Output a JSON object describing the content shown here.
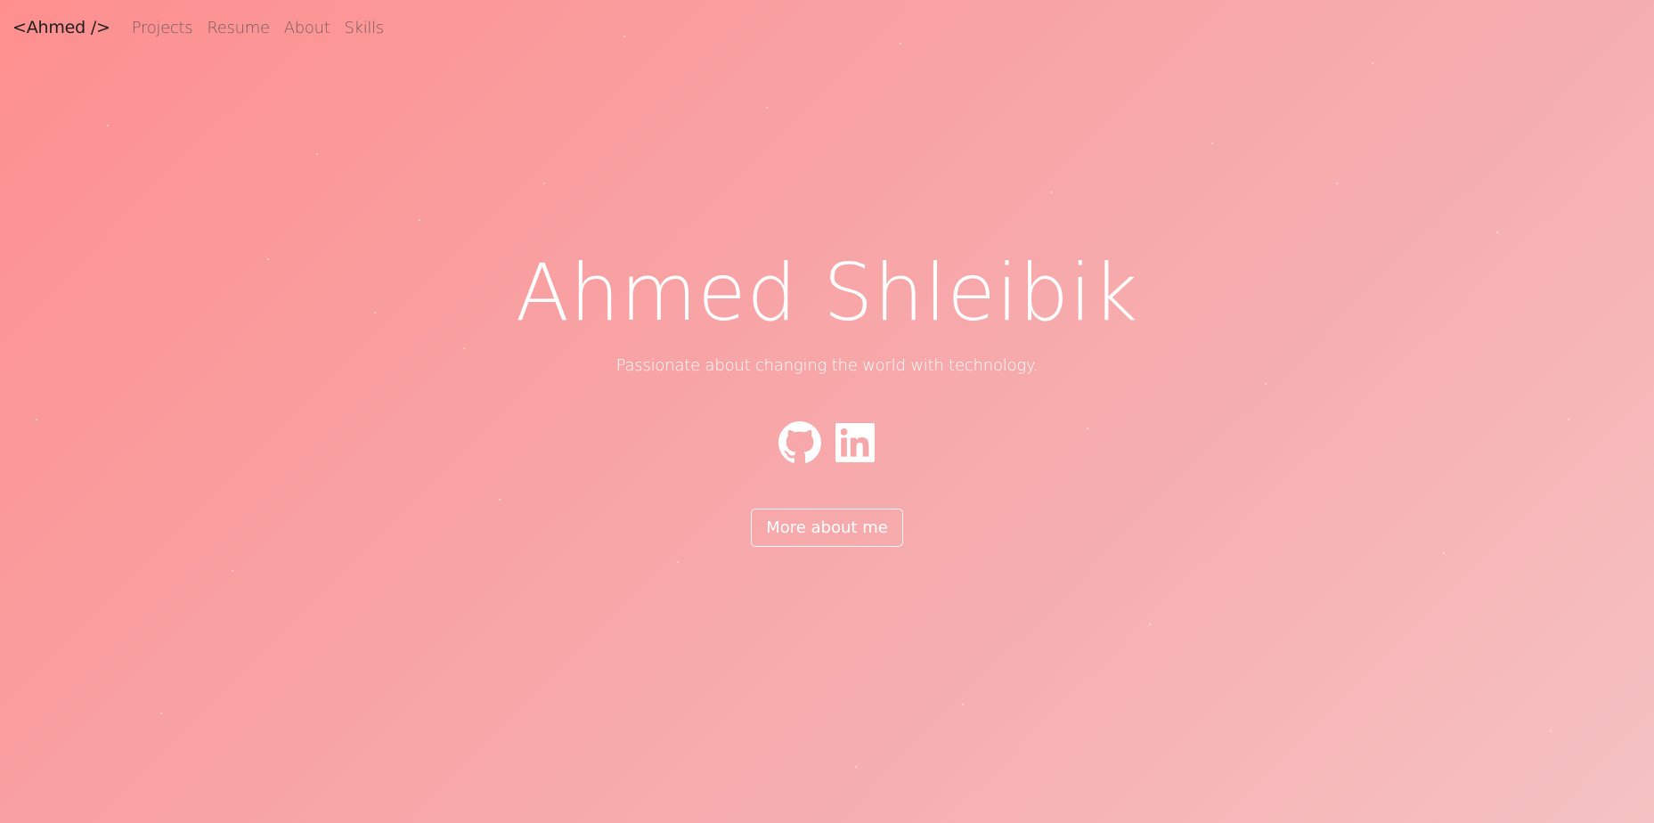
{
  "nav": {
    "brand": "<Ahmed />",
    "links": [
      "Projects",
      "Resume",
      "About",
      "Skills"
    ]
  },
  "hero": {
    "title": "Ahmed Shleibik",
    "subtitle": "Passionate about changing the world with technology.",
    "button_label": "More about me"
  },
  "socials": [
    {
      "icon": "github-icon"
    },
    {
      "icon": "linkedin-icon"
    }
  ],
  "colors": {
    "gradient_start": "#fe8f8f",
    "gradient_end": "#f5c2c3",
    "text_light": "#ffffff",
    "brand_text": "#1e1e1e",
    "nav_text": "#7a5a5c"
  }
}
